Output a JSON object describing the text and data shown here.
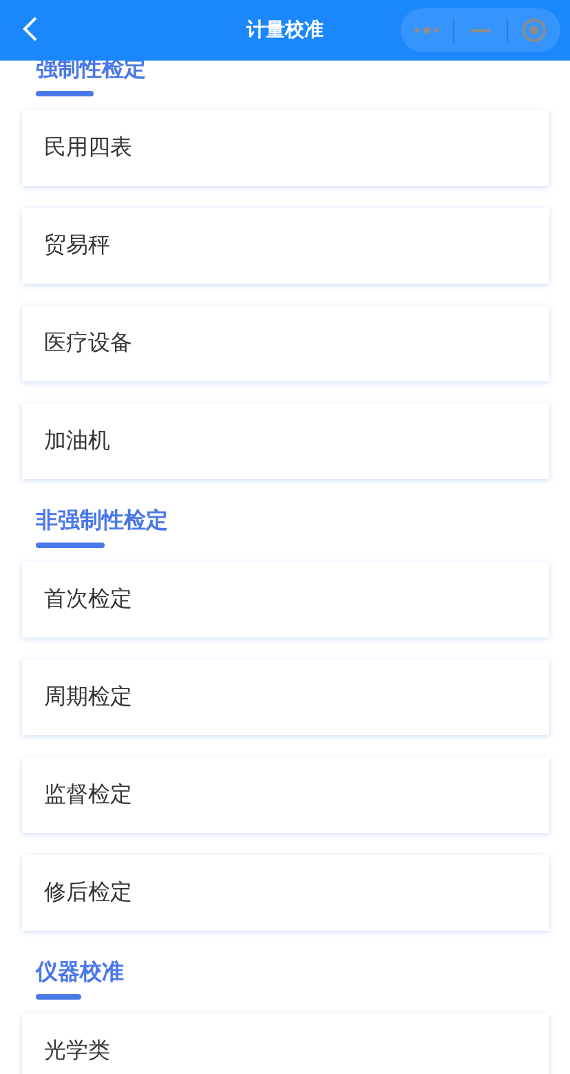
{
  "header": {
    "title": "计量校准"
  },
  "sections": [
    {
      "title": "强制性检定",
      "items": [
        "民用四表",
        "贸易秤",
        "医疗设备",
        "加油机"
      ]
    },
    {
      "title": "非强制性检定",
      "items": [
        "首次检定",
        "周期检定",
        "监督检定",
        "修后检定"
      ]
    },
    {
      "title": "仪器校准",
      "items": [
        "光学类"
      ]
    }
  ]
}
